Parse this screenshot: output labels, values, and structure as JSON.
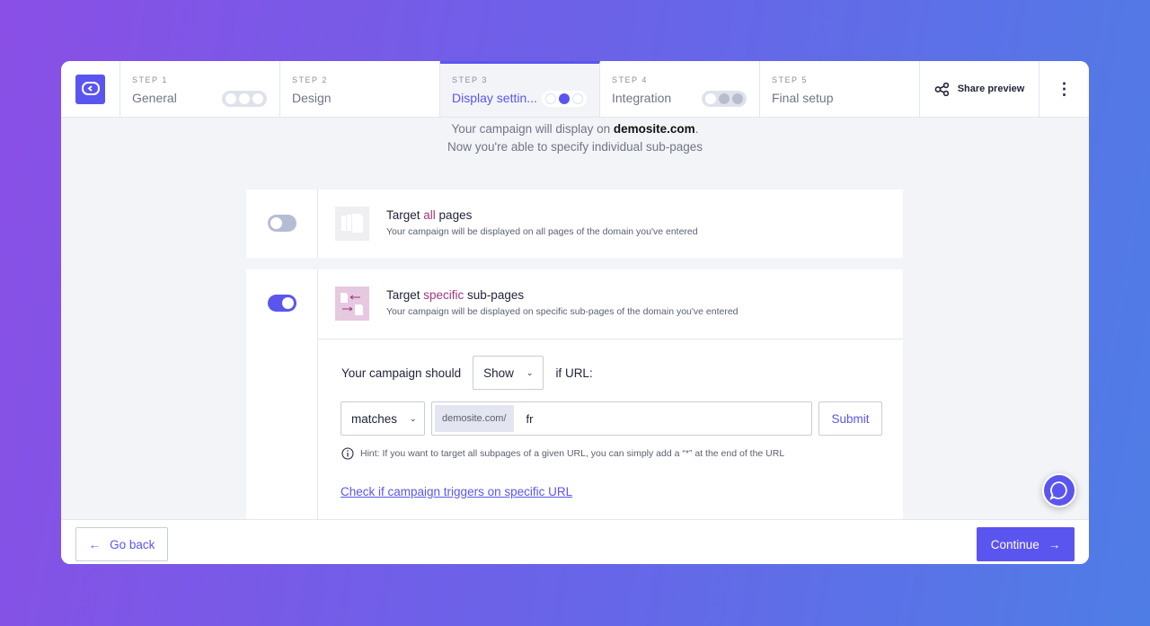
{
  "steps": [
    {
      "label": "STEP 1",
      "name": "General",
      "progress": "0 of 3"
    },
    {
      "label": "STEP 2",
      "name": "Design"
    },
    {
      "label": "STEP 3",
      "name": "Display settin...",
      "progress": "2 of 3",
      "active": true
    },
    {
      "label": "STEP 4",
      "name": "Integration",
      "progress": "1 of 3"
    },
    {
      "label": "STEP 5",
      "name": "Final setup"
    }
  ],
  "header": {
    "share_label": "Share preview",
    "more_label": "⋮"
  },
  "intro": {
    "line1_prefix": "Your campaign will display on ",
    "domain": "demosite.com",
    "line1_suffix": ".",
    "line2": "Now you're able to specify individual sub-pages"
  },
  "options": [
    {
      "title_pre": "Target ",
      "title_em": "all",
      "title_post": " pages",
      "desc": "Your campaign will be displayed on all pages of the domain you've entered",
      "enabled": false
    },
    {
      "title_pre": "Target ",
      "title_em": "specific",
      "title_post": " sub-pages",
      "desc": "Your campaign will be displayed on specific sub-pages of the domain you've entered",
      "enabled": true
    }
  ],
  "rule": {
    "prefix": "Your campaign should",
    "mode": "Show",
    "suffix": "if URL:",
    "match": "matches",
    "url_prefix": "demosite.com/",
    "url_value": "fr",
    "submit": "Submit"
  },
  "hint": "Hint: If you want to target all subpages of a given URL, you can simply add a “*” at the end of the URL",
  "check_link": "Check if campaign triggers on specific URL",
  "footer": {
    "back": "Go back",
    "continue": "Continue"
  },
  "colors": {
    "accent": "#5b55f0",
    "highlight": "#a0357f"
  }
}
